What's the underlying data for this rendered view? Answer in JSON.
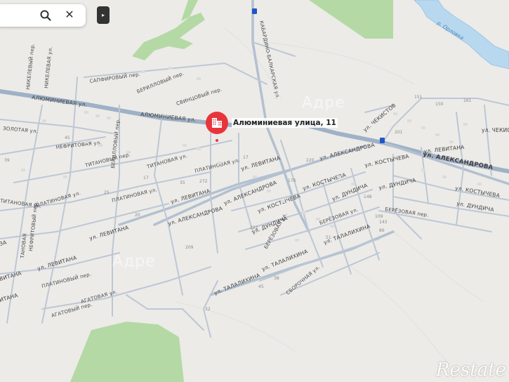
{
  "search": {
    "search_icon": "search-icon",
    "close_icon": "close-icon",
    "close_glyph": "✕",
    "collapse_glyph": "▸"
  },
  "marker": {
    "title": "Алюминиевая улица, 11",
    "icon": "building-pin-icon",
    "color": "#e8353b"
  },
  "watermark": "Restate",
  "ghost_watermarks": [
    "Адре",
    "Адре"
  ],
  "water": {
    "river_label": "р. Орловка"
  },
  "streets": {
    "aluminievaya_1": "АЛЮМИНИЕВАЯ ул.",
    "aluminievaya_2": "АЛЮМИНИЕВАЯ ул.",
    "safirovy": "САПФИРОВЫЙ пер.",
    "berillovy": "БЕРИЛЛОВЫЙ пер.",
    "svintsovy": "СВИНЦОВЫЙ пер.",
    "zolotaya": "ЗОЛОТАЯ ул.",
    "nefritovaya": "НЕФРИТОВАЯ ул.",
    "nikelevy": "НИКЕЛЕВЫЙ пер.",
    "nikelevaya": "НИКЕЛЕВАЯ ул.",
    "titanovy": "ТИТАНОВЫЙ пер.",
    "berillovy_vert": "БЕРИЛЛОВЫЙ пер.",
    "titanovaya_1": "ТИТАНОВАЯ ул.",
    "titanovaya_2": "ТИТАНОВАЯ ул.",
    "titanovaya_left": "ТИТАНОВАЯ ул.",
    "platinovaya_1": "ПЛАТИНОВАЯ ул.",
    "platinovaya_2": "ПЛАТИНОВАЯ ул.",
    "platinovaya_3": "ПЛАТИНОВАЯ ул.",
    "platinovy": "ПЛАТИНОВЫЙ пер.",
    "nefritovy": "НЕФРИТОВЫЙ пер.",
    "levitana_1": "ул. ЛЕВИТАНА",
    "levitana_2": "ул. ЛЕВИТАНА",
    "levitana_3": "ул. ЛЕВИТАНА",
    "levitana_4": "ул. ЛЕВИТАНА",
    "levitana_left": "ВИТАНА",
    "levitana_right": "ул. ЛЕВИТАНА",
    "alexandrova_1": "ул. АЛЕКСАНДРОВА",
    "alexandrova_2": "ул. АЛЕКСАНДРОВА",
    "alexandrova_3": "ул. АЛЕКСАНДРОВА",
    "alexandrova_4": "ул. АЛЕКСАНДРОВА",
    "alexandrova_left": "ЗА",
    "kostycheva_1": "ул. КОСТЫЧЕВА",
    "kostycheva_2": "ул. КОСТЫЧЕВА",
    "kostycheva_3": "ул. КОСТЫЧЕВА",
    "kostycheva_4": "ул. КОСТЫЧЕВА",
    "dundicha_1": "ул. ДУНДИЧА",
    "dundicha_2": "ул. ДУНДИЧА",
    "dundicha_3": "ул. ДУНДИЧА",
    "dundicha_4": "ул. ДУНДИЧА",
    "berezovaya_1": "БЕРЁЗОВАЯ ул.",
    "berezovaya_2": "БЕРЁЗОВАЯ ул.",
    "berezovaya_3": "БЕРЁЗОВАЯ пер.",
    "talalikhina_1": "ул. ТАЛАЛИХИНА",
    "talalikhina_2": "ул. ТАЛАЛИХИНА",
    "talalikhina_3": "ул. ТАЛАЛИХИНА",
    "sborochnaya": "СБОРОЧНАЯ ул.",
    "agatovaya": "АГАТОВАЯ ул.",
    "agatovy": "АГАТОВЫЙ пер.",
    "chekistov_1": "ул. ЧЕКИСТОВ",
    "chekistov_2": "ул. ЧЕКИСТ",
    "kabardino": "КАБАРДИНО-БАЛКАРСКАЯ ул.",
    "vitana_left_bottom": "ИТАНА",
    "titanovaya_far_left": "ТАНОВАЯ"
  },
  "house_numbers": [
    "45",
    "39",
    "17",
    "35",
    "25",
    "20",
    "17",
    "272",
    "220",
    "176",
    "148",
    "109",
    "222",
    "209",
    "161",
    "151",
    "150",
    "143",
    "86",
    "38",
    "45",
    "51",
    "32",
    "201"
  ]
}
